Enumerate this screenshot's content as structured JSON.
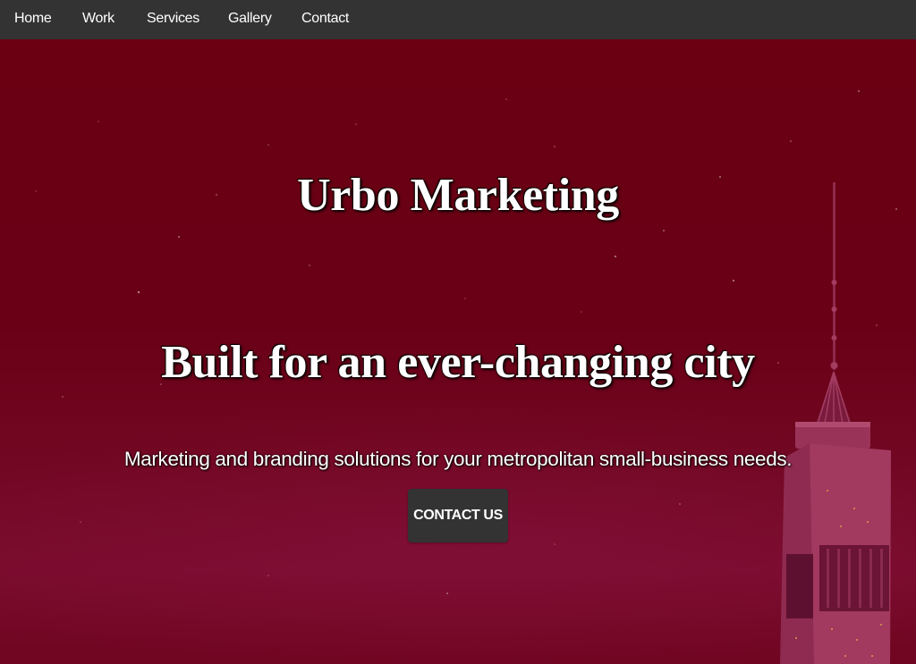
{
  "nav": {
    "items": [
      {
        "label": "Home"
      },
      {
        "label": "Work"
      },
      {
        "label": "Services"
      },
      {
        "label": "Gallery"
      },
      {
        "label": "Contact"
      }
    ]
  },
  "hero": {
    "title": "Urbo Marketing",
    "subtitle": "Built for an ever-changing city",
    "tagline": "Marketing and branding solutions for your metropolitan small-business needs.",
    "cta_label": "CONTACT US",
    "background_illustration": "skyscraper-tower-illustration"
  },
  "colors": {
    "navbar": "#333333",
    "hero_background": "#6a0013",
    "button": "#333333",
    "text": "#ffffff",
    "tower": "#a83c5e"
  }
}
